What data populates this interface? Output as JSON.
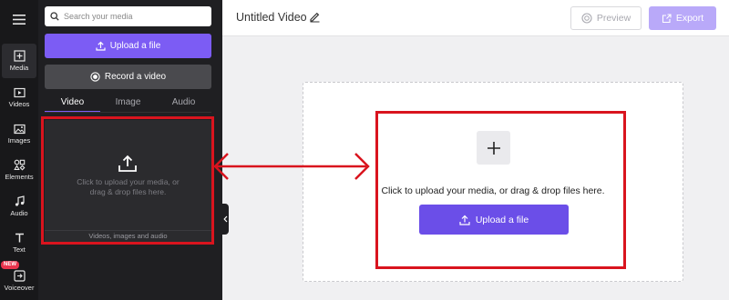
{
  "rail": {
    "items": [
      {
        "label": "Media",
        "icon": "media-icon"
      },
      {
        "label": "Videos",
        "icon": "videos-icon"
      },
      {
        "label": "Images",
        "icon": "images-icon"
      },
      {
        "label": "Elements",
        "icon": "elements-icon"
      },
      {
        "label": "Audio",
        "icon": "audio-icon"
      },
      {
        "label": "Text",
        "icon": "text-icon"
      },
      {
        "label": "Voiceover",
        "icon": "voiceover-icon"
      }
    ],
    "new_badge": "NEW"
  },
  "panel": {
    "search_placeholder": "Search your media",
    "upload_label": "Upload a file",
    "record_label": "Record a video",
    "tabs": [
      {
        "label": "Video"
      },
      {
        "label": "Image"
      },
      {
        "label": "Audio"
      }
    ],
    "dropzone_text": "Click to upload your media, or drag & drop files here.",
    "dropzone_footer": "Videos, images and audio"
  },
  "topbar": {
    "title": "Untitled Video",
    "preview_label": "Preview",
    "export_label": "Export"
  },
  "canvas": {
    "prompt": "Click to upload your media, or drag & drop files here.",
    "upload_label": "Upload a file"
  },
  "colors": {
    "accent": "#7c5cf4",
    "annotation": "#d9141e"
  }
}
